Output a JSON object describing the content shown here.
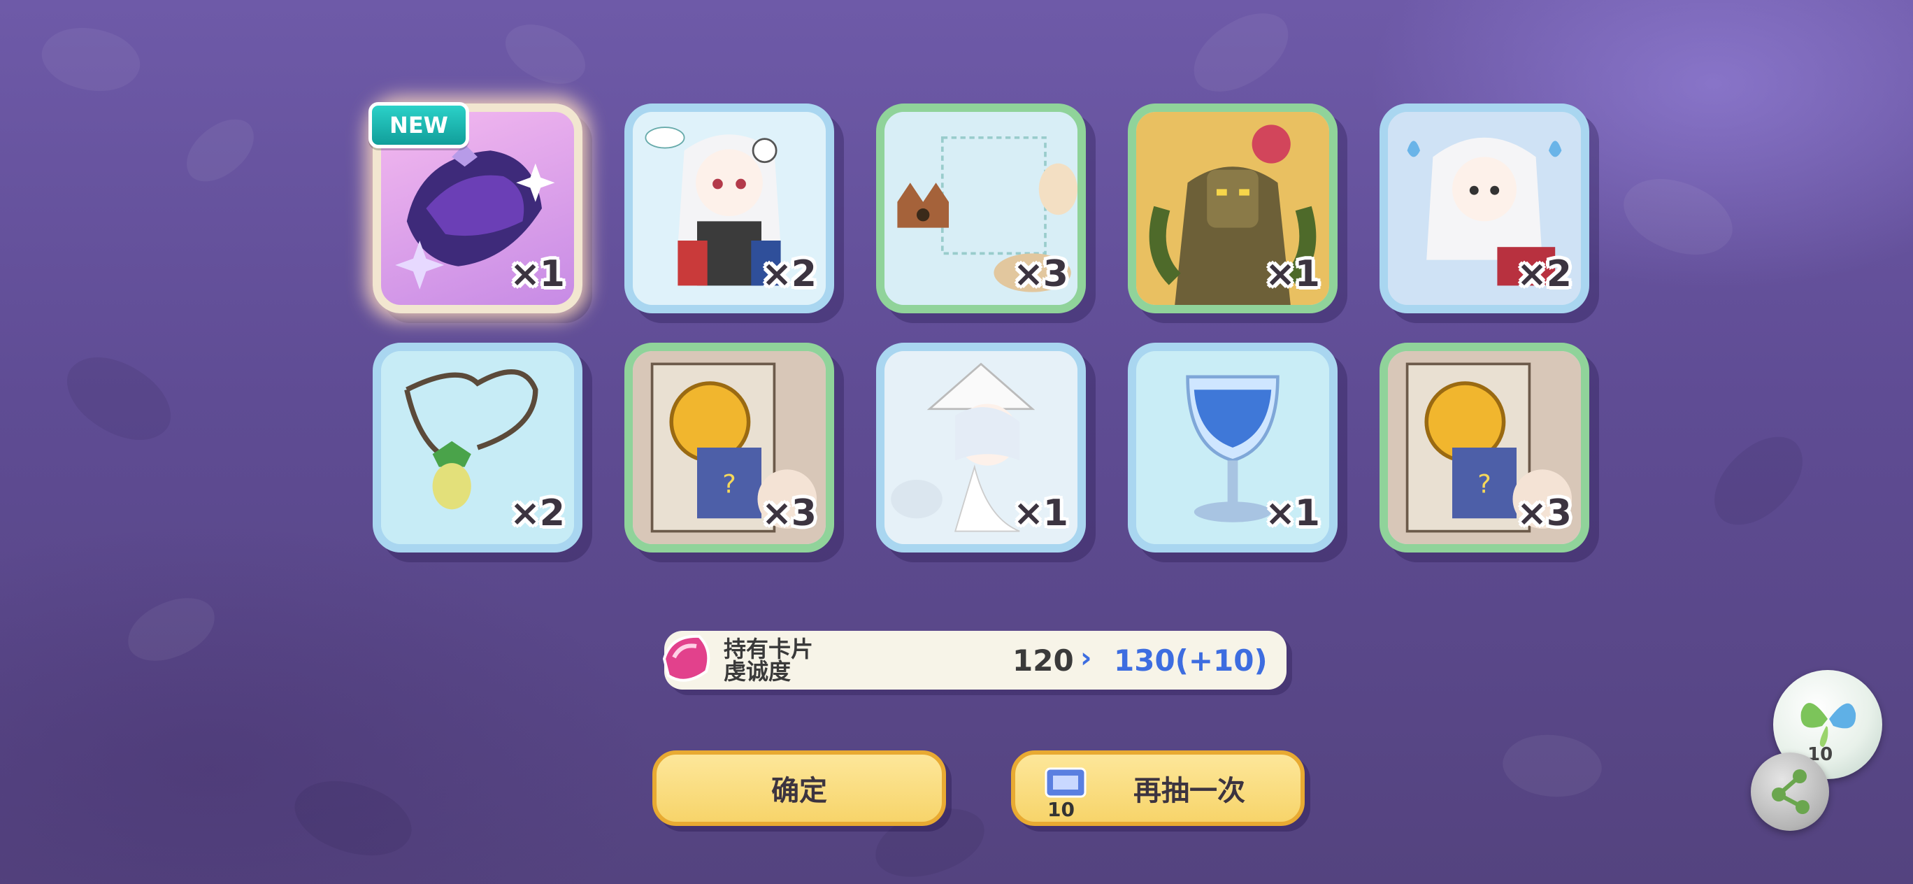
{
  "result": {
    "new_badge": "NEW",
    "cards": [
      {
        "item": "dark-hat",
        "qty": "×1",
        "rarity": "gold"
      },
      {
        "item": "white-hair-girl-cards",
        "qty": "×2",
        "rarity": "blue"
      },
      {
        "item": "cat-sketch",
        "qty": "×3",
        "rarity": "green"
      },
      {
        "item": "tree-golem",
        "qty": "×1",
        "rarity": "green"
      },
      {
        "item": "white-hair-girl-flames",
        "qty": "×2",
        "rarity": "blue"
      },
      {
        "item": "acorn-necklace",
        "qty": "×2",
        "rarity": "blue"
      },
      {
        "item": "gold-coin-card",
        "qty": "×3",
        "rarity": "green"
      },
      {
        "item": "witch-girl",
        "qty": "×1",
        "rarity": "blue"
      },
      {
        "item": "crystal-goblet",
        "qty": "×1",
        "rarity": "blue"
      },
      {
        "item": "gold-coin-card",
        "qty": "×3",
        "rarity": "green"
      }
    ]
  },
  "favor": {
    "label": "持有卡片\n虔诚度",
    "old_value": "120",
    "arrow": "›",
    "new_value": "130(+10)"
  },
  "buttons": {
    "confirm": "确定",
    "again": "再抽一次",
    "ticket_count": "10"
  },
  "side": {
    "bubble_count": "10"
  },
  "colors": {
    "button_fill": "#f7d46a",
    "button_border": "#e8aa32",
    "value_blue": "#3d6de0",
    "card_blue": "#a9d6f0",
    "card_green": "#90d39a"
  }
}
